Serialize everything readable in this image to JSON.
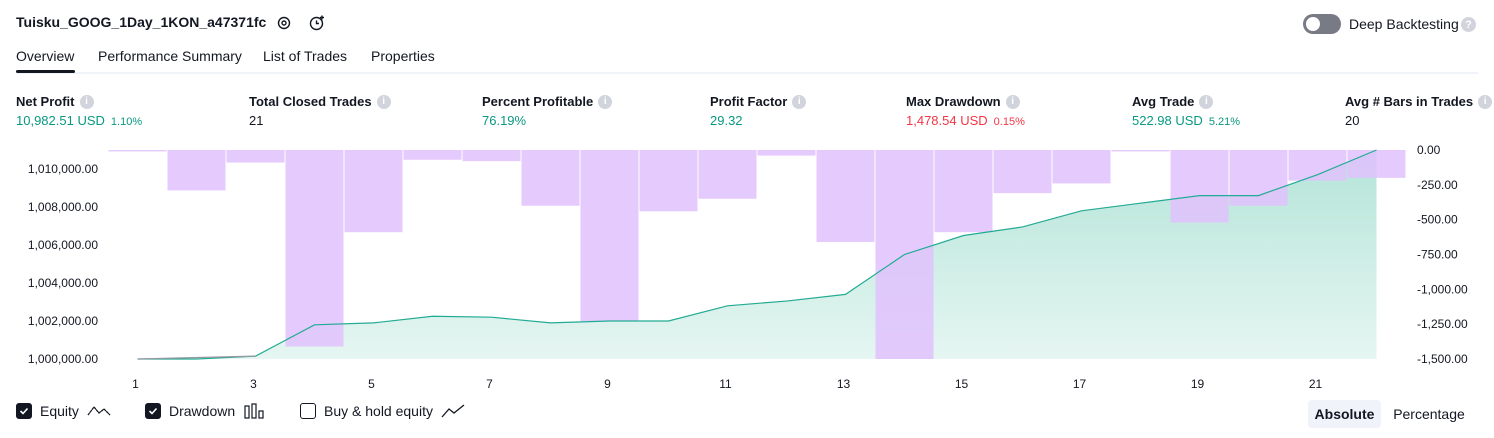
{
  "header": {
    "title": "Tuisku_GOOG_1Day_1KON_a47371fc",
    "deep_backtesting_label": "Deep Backtesting"
  },
  "tabs": [
    "Overview",
    "Performance Summary",
    "List of Trades",
    "Properties"
  ],
  "metrics": {
    "net_profit": {
      "label": "Net Profit",
      "value": "10,982.51 USD",
      "pct": "1.10%"
    },
    "total_closed_trades": {
      "label": "Total Closed Trades",
      "value": "21"
    },
    "percent_profitable": {
      "label": "Percent Profitable",
      "value": "76.19%"
    },
    "profit_factor": {
      "label": "Profit Factor",
      "value": "29.32"
    },
    "max_drawdown": {
      "label": "Max Drawdown",
      "value": "1,478.54 USD",
      "pct": "0.15%"
    },
    "avg_trade": {
      "label": "Avg Trade",
      "value": "522.98 USD",
      "pct": "5.21%"
    },
    "avg_bars": {
      "label": "Avg # Bars in Trades",
      "value": "20"
    }
  },
  "chart_data": {
    "type": "line",
    "x": [
      1,
      2,
      3,
      4,
      5,
      6,
      7,
      8,
      9,
      10,
      11,
      12,
      13,
      14,
      15,
      16,
      17,
      18,
      19,
      20,
      21,
      22
    ],
    "x_ticks": [
      "1",
      "3",
      "5",
      "7",
      "9",
      "11",
      "13",
      "15",
      "17",
      "19",
      "21"
    ],
    "left_ticks": [
      "1,010,000.00",
      "1,008,000.00",
      "1,006,000.00",
      "1,004,000.00",
      "1,002,000.00",
      "1,000,000.00"
    ],
    "right_ticks": [
      "0.00",
      "-250.00",
      "-500.00",
      "-750.00",
      "-1,000.00",
      "-1,250.00",
      "-1,500.00"
    ],
    "ylim_left": [
      1000000,
      1011000
    ],
    "ylim_right": [
      -1500,
      0
    ],
    "series": [
      {
        "name": "Equity",
        "values": [
          1000000,
          1000000,
          1000150,
          1001800,
          1001900,
          1002250,
          1002200,
          1001900,
          1002000,
          1002000,
          1002800,
          1003050,
          1003400,
          1005500,
          1006500,
          1006950,
          1007800,
          1008200,
          1008600,
          1008600,
          1009700,
          1011000
        ]
      },
      {
        "name": "Drawdown",
        "values": [
          -10,
          -290,
          -90,
          -1410,
          -590,
          -70,
          -80,
          -400,
          -1230,
          -440,
          -350,
          -40,
          -660,
          -1500,
          -590,
          -310,
          -240,
          -10,
          -520,
          -400,
          -220,
          -200
        ]
      }
    ],
    "colors": {
      "equity_line": "#22ab94",
      "equity_fill": "#d6f0ea",
      "drawdown": "#e1c1fd",
      "overlap": "#c1bdf0"
    }
  },
  "legend": {
    "equity_label": "Equity",
    "drawdown_label": "Drawdown",
    "buy_hold_label": "Buy & hold equity",
    "absolute_label": "Absolute",
    "percentage_label": "Percentage"
  }
}
